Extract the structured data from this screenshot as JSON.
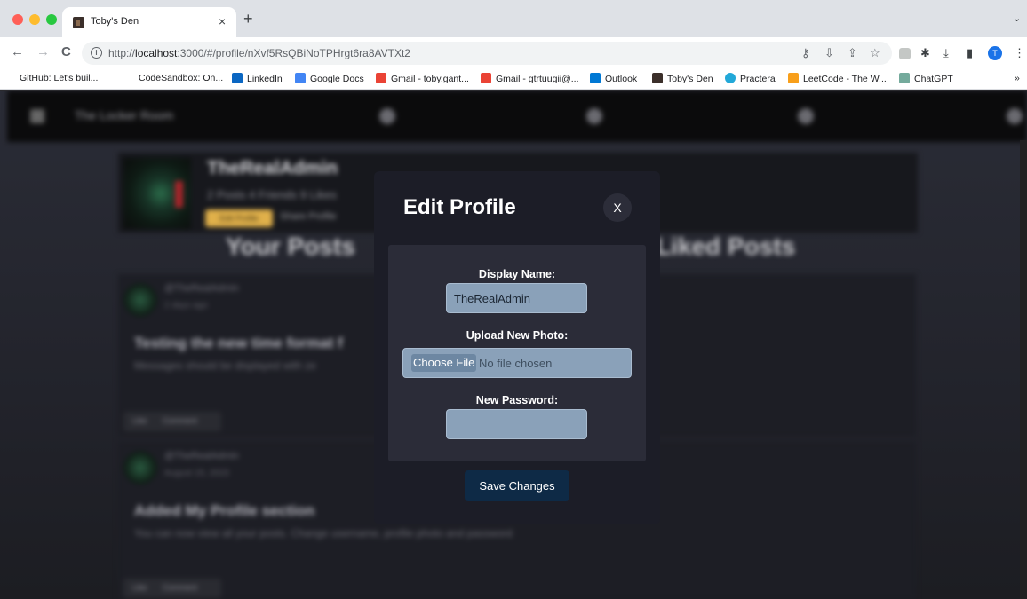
{
  "browser": {
    "tab_title": "Toby's Den",
    "tab_close": "×",
    "new_tab": "+",
    "tab_menu": "⌄",
    "url_host": "localhost",
    "url_prefix": "http://",
    "url_rest": ":3000/#/profile/nXvf5RsQBiNoTPHrgt6ra8AVTXt2",
    "profile_initial": "T",
    "nav": {
      "back": "←",
      "forward": "→",
      "reload": "C"
    },
    "bookmarks": [
      {
        "label": "GitHub: Let's buil...",
        "icon_color": "#ffffff"
      },
      {
        "label": "CodeSandbox: On...",
        "icon_color": "#ffffff"
      },
      {
        "label": "LinkedIn",
        "icon_color": "#0a66c2"
      },
      {
        "label": "Google Docs",
        "icon_color": "#4285f4"
      },
      {
        "label": "Gmail - toby.gant...",
        "icon_color": "#ea4335"
      },
      {
        "label": "Gmail - gtrtuugii@...",
        "icon_color": "#ea4335"
      },
      {
        "label": "Outlook",
        "icon_color": "#0078d4"
      },
      {
        "label": "Toby's Den",
        "icon_color": "#3b2f2a"
      },
      {
        "label": "Practera",
        "icon_color": "#22a8d8"
      },
      {
        "label": "LeetCode - The W...",
        "icon_color": "#f89f1b"
      },
      {
        "label": "ChatGPT",
        "icon_color": "#74aa9c"
      }
    ],
    "bookmarks_more": "»"
  },
  "app": {
    "brand": "The Locker Room",
    "profile_name": "TheRealAdmin",
    "profile_stats": "2 Posts  4 Friends  9 Likes",
    "edit_chip": "Edit Profile",
    "share_label": "Share Profile",
    "tab_your_posts": "Your Posts",
    "tab_liked_posts": "Liked Posts",
    "posts": [
      {
        "user": "@TheRealAdmin",
        "time": "2 days ago",
        "title": "Testing the new time format f",
        "body": "Messages should be displayed with ze",
        "like": "Like",
        "comment": "Comment"
      },
      {
        "user": "@TheRealAdmin",
        "time": "August 15, 2023",
        "title": "Added My Profile section",
        "body": "You can now view all your posts. Change username, profile photo and password",
        "like": "Like",
        "comment": "Comment"
      }
    ]
  },
  "modal": {
    "title": "Edit Profile",
    "close_label": "X",
    "display_name_label": "Display Name:",
    "display_name_value": "TheRealAdmin",
    "upload_label": "Upload New Photo:",
    "choose_file_label": "Choose File",
    "no_file_text": "No file chosen",
    "password_label": "New Password:",
    "password_value": "",
    "save_label": "Save Changes"
  }
}
